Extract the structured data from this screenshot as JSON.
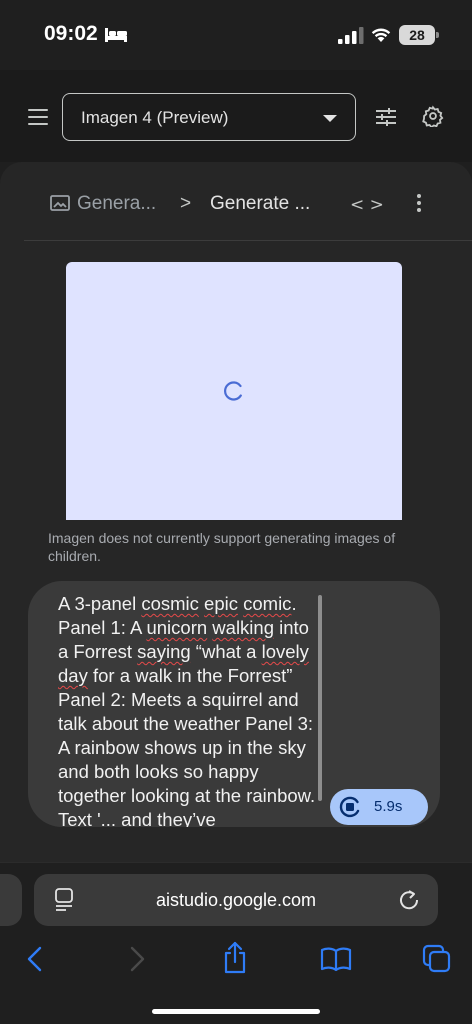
{
  "status_bar": {
    "time": "09:02",
    "battery": "28",
    "icons": [
      "bed-icon",
      "signal-icon",
      "wifi-icon",
      "battery-icon"
    ]
  },
  "header": {
    "model_select": "Imagen 4 (Preview)",
    "icons": [
      "menu-icon",
      "chevron-down-icon",
      "tune-icon",
      "gear-icon"
    ]
  },
  "breadcrumb": {
    "item1": "Genera...",
    "separator": ">",
    "item2": "Generate ...",
    "code_toggle": "< >",
    "icons": [
      "image-icon",
      "code-icon",
      "more-vert-icon"
    ]
  },
  "output": {
    "notice": "Imagen does not currently support generating images of children."
  },
  "prompt": {
    "segments": [
      {
        "text": "A 3-panel ",
        "error": false
      },
      {
        "text": "cosmic",
        "error": true
      },
      {
        "text": " ",
        "error": false
      },
      {
        "text": "epic",
        "error": true
      },
      {
        "text": " ",
        "error": false
      },
      {
        "text": "comic",
        "error": true
      },
      {
        "text": ". Panel 1: A ",
        "error": false
      },
      {
        "text": "unicorn",
        "error": true
      },
      {
        "text": " ",
        "error": false
      },
      {
        "text": "walking",
        "error": true
      },
      {
        "text": " into a Forrest ",
        "error": false
      },
      {
        "text": "saying",
        "error": true
      },
      {
        "text": " “what a ",
        "error": false
      },
      {
        "text": "lovely",
        "error": true
      },
      {
        "text": " ",
        "error": false
      },
      {
        "text": "day",
        "error": true
      },
      {
        "text": " for a walk in the Forrest” Panel 2: Meets a squirrel and talk about the weather  Panel 3: A rainbow shows up in the sky and both looks so happy together looking at the rainbow. Text '... and they’ve",
        "error": false
      }
    ],
    "run_time": "5.9s",
    "icons": [
      "stop-icon"
    ]
  },
  "browser": {
    "url": "aistudio.google.com",
    "icons": [
      "page-menu-icon",
      "reload-icon",
      "back-icon",
      "forward-icon",
      "share-icon",
      "bookmarks-icon",
      "tabs-icon"
    ],
    "colors": {
      "accent": "#2f7cf6",
      "disabled": "#4a4a4a"
    }
  }
}
